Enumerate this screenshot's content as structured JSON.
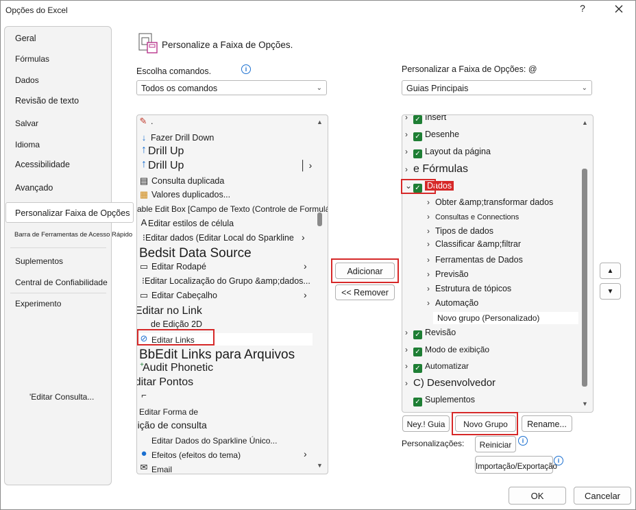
{
  "window": {
    "title": "Opções do Excel",
    "help": "?",
    "close": "✕"
  },
  "nav": {
    "items": [
      "Geral",
      "Fórmulas",
      "Dados",
      "Revisão de texto",
      "Salvar",
      "Idioma",
      "Acessibilidade",
      "Avançado",
      "Personalizar Faixa de Opções",
      "Barra de Ferramentas de Acesso Rápido",
      "Suplementos",
      "Central de Confiabilidade",
      "Experimento",
      "'Editar Consulta..."
    ]
  },
  "header": {
    "title": "Personalize a Faixa de Opções."
  },
  "left": {
    "choose_label": "Escolha comandos.",
    "choose_value": "Todos os comandos",
    "items": [
      ".",
      "Fazer Drill Down",
      "Drill Up",
      "Drill Up",
      "Consulta duplicada",
      "Valores duplicados...",
      "able Edit Box [Campo de Texto (Controle de Formulário))",
      "Editar estilos de célula",
      "Editar dados (Editar Local do Sparkline",
      "Bedsit Data Source",
      "Editar Rodapé",
      "Editar Localização do Grupo &amp;dados...",
      "Editar Cabeçalho",
      "'Editar no Link",
      "de Edição 2D",
      "Editar Links",
      "BbEdit Links para Arquivos",
      "Audit Phonetic",
      "• Editar Pontos",
      "Editar Forma de",
      "edição de consulta",
      "Editar Dados do Sparkline Único...",
      "Efeitos (efeitos do tema)",
      "Email"
    ]
  },
  "middle": {
    "add": "Adicionar",
    "remove": "<< Remover"
  },
  "right": {
    "customize_label": "Personalizar a Faixa de Opções: @",
    "customize_value": "Guias Principais",
    "items": [
      "Insert",
      "Desenhe",
      "Layout da página",
      "e Fórmulas",
      "Dados",
      "Obter &amp;transformar dados",
      "Consultas e Connections",
      "Tipos de dados",
      "Classificar &amp;filtrar",
      "Ferramentas de Dados",
      "Previsão",
      "Estrutura de tópicos",
      "Automação",
      "Novo grupo (Personalizado)",
      "Revisão",
      "Modo de exibição",
      "Automatizar",
      "C) Desenvolvedor",
      "Suplementos"
    ],
    "new_tab": "Ney.! Guia",
    "new_group": "Novo Grupo",
    "rename": "Rename...",
    "customizations_label": "Personalizações:",
    "reset": "Reiniciar",
    "import_export": "Importação/Exportação"
  },
  "footer": {
    "ok": "OK",
    "cancel": "Cancelar"
  }
}
